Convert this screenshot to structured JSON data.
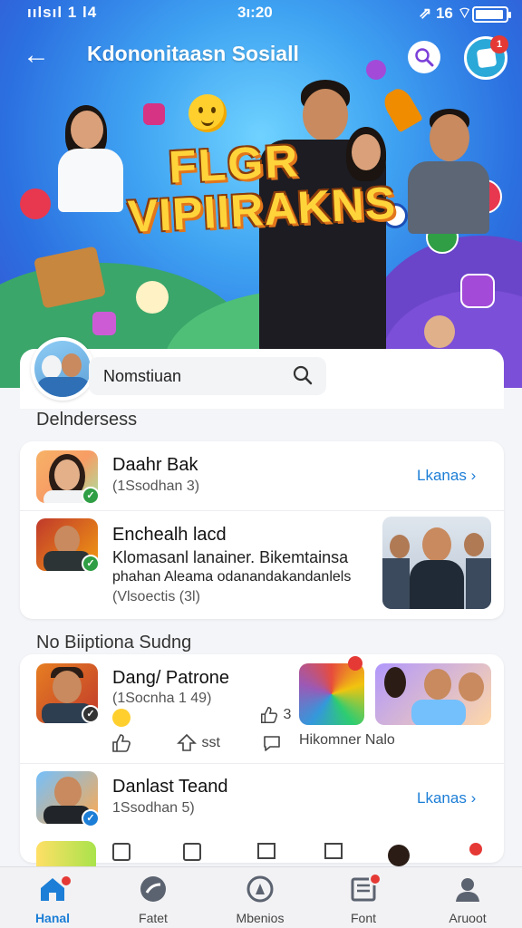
{
  "status_bar": {
    "signal": "ıılsıl 1 l4",
    "time": "3ı:20",
    "icons": "⇗ 16 ⌔"
  },
  "header": {
    "title": "Kdononitaasn Sosiall",
    "back_icon": "back-arrow-icon",
    "search_icon": "search-icon",
    "badge_count": "1"
  },
  "banner": {
    "line1": "FLGR",
    "line2": "VIPIIRAKNS"
  },
  "profile": {
    "search_value": "Nomstiuan"
  },
  "section1": {
    "title": "Delndersess",
    "items": [
      {
        "name": "Daahr Bak",
        "sub": "(1Ssodhan 3)",
        "link": "Lkanas"
      },
      {
        "name": "Enchealh lacd",
        "body1": "Klomasanl lanainer. Bikemtainsa",
        "body2": "phahan Aleama odanandakandanlels",
        "body3": "(Vlsoectis (3l)"
      }
    ]
  },
  "section2": {
    "title": "No Biiptiona Sudng",
    "items": [
      {
        "name": "Dang/ Patrone",
        "sub": "(1Socnha 1 49)",
        "likes": "3",
        "share": "sst",
        "comment_text": "Hikomner Nalo"
      },
      {
        "name": "Danlast Teand",
        "sub": "1Ssodhan 5)",
        "link": "Lkanas"
      }
    ]
  },
  "bottom_nav": [
    {
      "label": "Hanal",
      "icon": "home-icon",
      "active": true,
      "badge": true
    },
    {
      "label": "Fatet",
      "icon": "explore-icon",
      "active": false,
      "badge": false
    },
    {
      "label": "Mbenios",
      "icon": "circle-icon",
      "active": false,
      "badge": false
    },
    {
      "label": "Font",
      "icon": "news-icon",
      "active": false,
      "badge": true
    },
    {
      "label": "Aruoot",
      "icon": "profile-icon",
      "active": false,
      "badge": false
    }
  ],
  "colors": {
    "accent": "#1c7ed6",
    "badge": "#e53935",
    "banner_text": "#ffd43b"
  }
}
